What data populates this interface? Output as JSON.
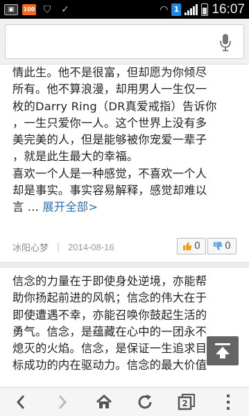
{
  "status_bar": {
    "badge_100": "100",
    "sim_badge": "1",
    "time": "16:07"
  },
  "search": {
    "placeholder": ""
  },
  "post1": {
    "lines": [
      "情此生。他不是很富，但却愿为你倾尽",
      "所有。他不算浪漫，却用男人一生仅一",
      "枚的Darry Ring（DR真爱戒指）告诉你",
      "，一生只爱你一人。这个世界上没有多",
      "美完美的人，但是能够被你宠爱一辈子",
      "，就是此生最大的幸福。",
      "喜欢一个人是一种感觉，不喜欢一个人",
      "却是事实。事实容易解释，感觉却难以"
    ],
    "last_line_prefix": "言 ... ",
    "expand_label": "展开全部>",
    "author": "冰阳心梦",
    "separator": "|",
    "date": "2014-08-16",
    "up_count": "0",
    "down_count": "0"
  },
  "post2": {
    "lines": [
      "信念的力量在于即使身处逆境，亦能帮",
      "助你扬起前进的风帆；信念的伟大在于",
      "即使遭遇不幸，亦能召唤你鼓起生活的",
      "勇气。信念，是蕴藏在心中的一团永不",
      "熄灭的火焰。信念，是保证一生追求目",
      "标成功的内在驱动力。信念的最大价值"
    ]
  },
  "nav": {
    "tab_count": "2"
  },
  "colors": {
    "link": "#2a6fb5",
    "status_bar": "#000000",
    "sim_badge": "#1e88e5",
    "badge_100": "#f26b1d"
  }
}
